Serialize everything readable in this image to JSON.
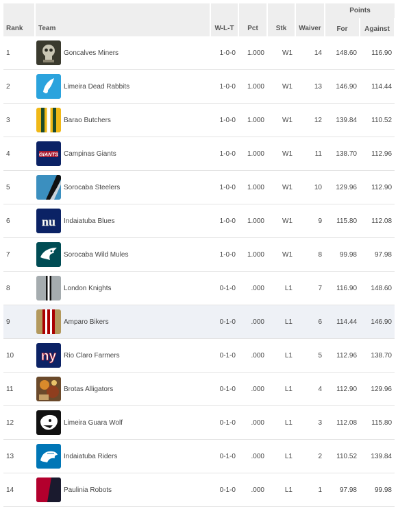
{
  "header": {
    "rank": "Rank",
    "team": "Team",
    "wlt": "W-L-T",
    "pct": "Pct",
    "stk": "Stk",
    "waiver": "Waiver",
    "points": "Points",
    "for": "For",
    "against": "Against"
  },
  "rows": [
    {
      "rank": "1",
      "team": "Goncalves Miners",
      "wlt": "1-0-0",
      "pct": "1.000",
      "stk": "W1",
      "waiver": "14",
      "for": "148.60",
      "against": "116.90",
      "logo_icon": "skull-logo-icon"
    },
    {
      "rank": "2",
      "team": "Limeira Dead Rabbits",
      "wlt": "1-0-0",
      "pct": "1.000",
      "stk": "W1",
      "waiver": "13",
      "for": "146.90",
      "against": "114.44",
      "logo_icon": "rabbit-logo-icon"
    },
    {
      "rank": "3",
      "team": "Barao Butchers",
      "wlt": "1-0-0",
      "pct": "1.000",
      "stk": "W1",
      "waiver": "12",
      "for": "139.84",
      "against": "110.52",
      "logo_icon": "stripes-logo-icon"
    },
    {
      "rank": "4",
      "team": "Campinas Giants",
      "wlt": "1-0-0",
      "pct": "1.000",
      "stk": "W1",
      "waiver": "11",
      "for": "138.70",
      "against": "112.96",
      "logo_icon": "giants-logo-icon",
      "logo_text": "GIANTS"
    },
    {
      "rank": "5",
      "team": "Sorocaba Steelers",
      "wlt": "1-0-0",
      "pct": "1.000",
      "stk": "W1",
      "waiver": "10",
      "for": "129.96",
      "against": "112.90",
      "logo_icon": "diagonal-stripe-logo-icon"
    },
    {
      "rank": "6",
      "team": "Indaiatuba Blues",
      "wlt": "1-0-0",
      "pct": "1.000",
      "stk": "W1",
      "waiver": "9",
      "for": "115.80",
      "against": "112.08",
      "logo_icon": "nu-logo-icon",
      "logo_text": "nu"
    },
    {
      "rank": "7",
      "team": "Sorocaba Wild Mules",
      "wlt": "1-0-0",
      "pct": "1.000",
      "stk": "W1",
      "waiver": "8",
      "for": "99.98",
      "against": "97.98",
      "logo_icon": "eagle-logo-icon"
    },
    {
      "rank": "8",
      "team": "London Knights",
      "wlt": "0-1-0",
      "pct": ".000",
      "stk": "L1",
      "waiver": "7",
      "for": "116.90",
      "against": "148.60",
      "logo_icon": "helmet-stripe-logo-icon"
    },
    {
      "rank": "9",
      "team": "Amparo Bikers",
      "wlt": "0-1-0",
      "pct": ".000",
      "stk": "L1",
      "waiver": "6",
      "for": "114.44",
      "against": "146.90",
      "logo_icon": "red-stripe-logo-icon"
    },
    {
      "rank": "10",
      "team": "Rio Claro Farmers",
      "wlt": "0-1-0",
      "pct": ".000",
      "stk": "L1",
      "waiver": "5",
      "for": "112.96",
      "against": "138.70",
      "logo_icon": "ny-logo-icon",
      "logo_text": "ny"
    },
    {
      "rank": "11",
      "team": "Brotas Alligators",
      "wlt": "0-1-0",
      "pct": ".000",
      "stk": "L1",
      "waiver": "4",
      "for": "112.90",
      "against": "129.96",
      "logo_icon": "photo-logo-icon"
    },
    {
      "rank": "12",
      "team": "Limeira Guara Wolf",
      "wlt": "0-1-0",
      "pct": ".000",
      "stk": "L1",
      "waiver": "3",
      "for": "112.08",
      "against": "115.80",
      "logo_icon": "jaguar-logo-icon"
    },
    {
      "rank": "13",
      "team": "Indaiatuba Riders",
      "wlt": "0-1-0",
      "pct": ".000",
      "stk": "L1",
      "waiver": "2",
      "for": "110.52",
      "against": "139.84",
      "logo_icon": "lion-logo-icon"
    },
    {
      "rank": "14",
      "team": "Paulinia Robots",
      "wlt": "0-1-0",
      "pct": ".000",
      "stk": "L1",
      "waiver": "1",
      "for": "97.98",
      "against": "99.98",
      "logo_icon": "dark-red-logo-icon"
    }
  ],
  "highlighted_rank": "9",
  "colors": {
    "header_bg": "#eeeeee",
    "row_highlight": "#eef1f6",
    "divider": "#e3e3e3"
  }
}
